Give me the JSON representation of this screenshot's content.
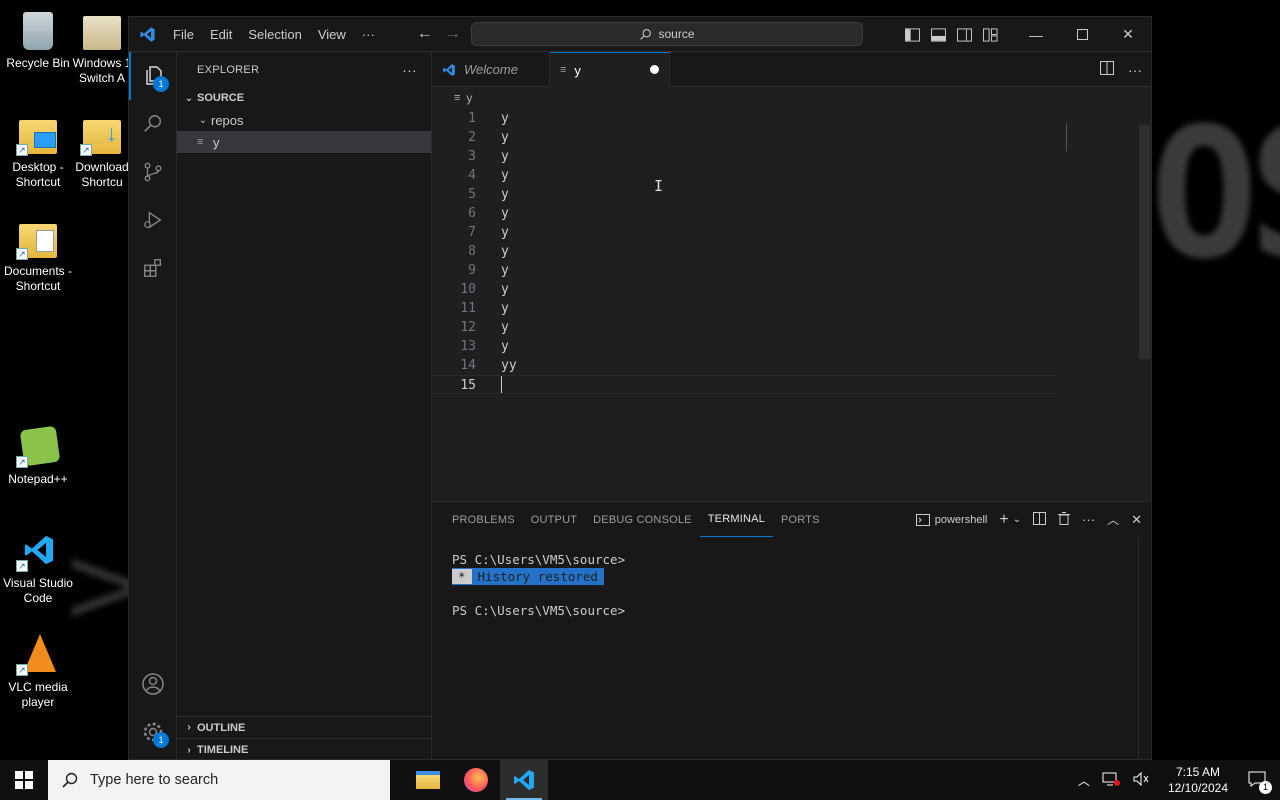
{
  "desktop": {
    "icons": [
      {
        "label": "Recycle Bin"
      },
      {
        "label": "Windows 1 Switch A"
      },
      {
        "label": "Desktop - Shortcut"
      },
      {
        "label": "Download Shortcu"
      },
      {
        "label": "Documents - Shortcut"
      },
      {
        "label": "Notepad++"
      },
      {
        "label": "Visual Studio Code"
      },
      {
        "label": "VLC media player"
      }
    ]
  },
  "titlebar": {
    "menus": [
      "File",
      "Edit",
      "Selection",
      "View",
      "···"
    ],
    "search_text": "source"
  },
  "activity": {
    "explorer_badge": "1",
    "settings_badge": "1"
  },
  "sidebar": {
    "title": "EXPLORER",
    "more": "···",
    "root": "SOURCE",
    "folder": "repos",
    "file": "y",
    "outline": "OUTLINE",
    "timeline": "TIMELINE"
  },
  "editor": {
    "tabs": [
      {
        "label": "Welcome"
      },
      {
        "label": "y",
        "dirty": true
      }
    ],
    "breadcrumb": "y",
    "lines": [
      {
        "n": "1",
        "text": "y"
      },
      {
        "n": "2",
        "text": "y"
      },
      {
        "n": "3",
        "text": "y"
      },
      {
        "n": "4",
        "text": "y"
      },
      {
        "n": "5",
        "text": "y"
      },
      {
        "n": "6",
        "text": "y"
      },
      {
        "n": "7",
        "text": "y"
      },
      {
        "n": "8",
        "text": "y"
      },
      {
        "n": "9",
        "text": "y"
      },
      {
        "n": "10",
        "text": "y"
      },
      {
        "n": "11",
        "text": "y"
      },
      {
        "n": "12",
        "text": "y"
      },
      {
        "n": "13",
        "text": "y"
      },
      {
        "n": "14",
        "text": "yy"
      },
      {
        "n": "15",
        "text": ""
      }
    ]
  },
  "panel": {
    "tabs": [
      "PROBLEMS",
      "OUTPUT",
      "DEBUG CONSOLE",
      "TERMINAL",
      "PORTS"
    ],
    "active_tab": "TERMINAL",
    "shell": "powershell",
    "terminal": {
      "prompt1": "PS C:\\Users\\VM5\\source>",
      "history_star": "*",
      "history_text": "History restored",
      "prompt2": "PS C:\\Users\\VM5\\source>"
    }
  },
  "taskbar": {
    "search_placeholder": "Type here to search",
    "time": "7:15 AM",
    "date": "12/10/2024",
    "notification_count": "1"
  }
}
